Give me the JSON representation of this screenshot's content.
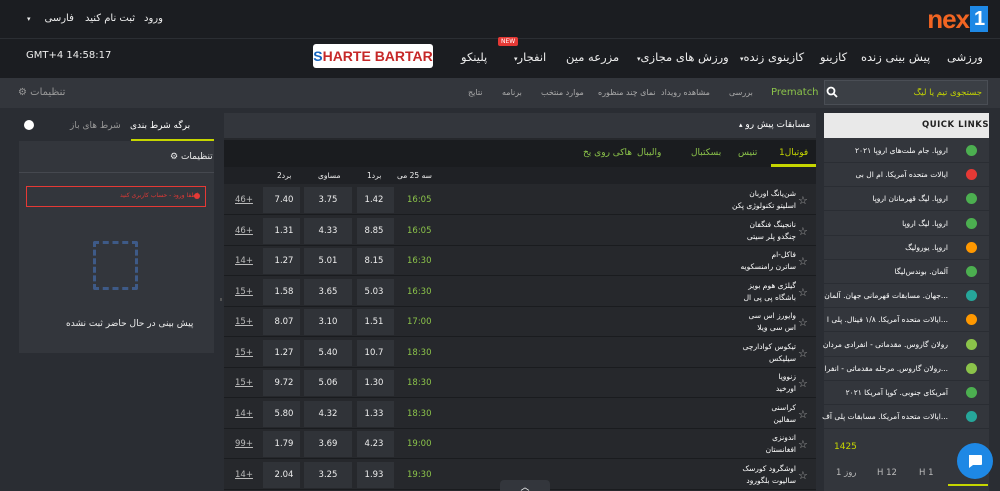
{
  "top": {
    "language": "فارسی",
    "register": "ثبت نام کنید",
    "login": "ورود",
    "clock": "GMT+4 14:58:17"
  },
  "brand": {
    "a": "S",
    "b": "HARTE BARTAR"
  },
  "logo": {
    "text": "nex",
    "one": "1"
  },
  "nav": {
    "sports": "ورزشی",
    "live": "پیش بینی زنده",
    "casino": "کازینو",
    "live_casino": "کازینوی زنده",
    "virtual": "ورزش های مجازی",
    "minefield": "مزرعه مین",
    "crash": "انفجار",
    "plinko": "پلینکو",
    "new_badge": "NEW"
  },
  "subnav": {
    "search_placeholder": "جستجوی تیم یا لیگ",
    "prematch": "Prematch",
    "review": "بررسی",
    "event_view": "مشاهده رویداد",
    "multi_view": "نمای چند منظوره",
    "favorites": "موارد منتخب",
    "schedule": "برنامه",
    "results": "نتایج",
    "settings": "تنظیمات"
  },
  "betslip": {
    "tab_betslip": "برگه شرط بندی",
    "tab_open": "شرط های باز",
    "settings": "تنظیمات",
    "error": "لطفا ورود - حساب کاربری کنید",
    "empty": "پیش بینی در حال حاضر ثبت نشده"
  },
  "main": {
    "title": "مسابقات پیش رو",
    "tabs": [
      "فوتبال1",
      "تنیس",
      "بسکتبال",
      "والیبال",
      "هاکی روی یخ"
    ],
    "columns": {
      "date": "سه 25 می",
      "home": "برد1",
      "draw": "مساوی",
      "away": "برد2"
    },
    "matches": [
      {
        "team1": "شن‌یانگ اوربان",
        "team2": "اسلیتو تکنولوژی پکن",
        "time": "16:05",
        "o1": "1.42",
        "ox": "3.75",
        "o2": "7.40",
        "more": "46+"
      },
      {
        "team1": "نانجینگ فنگفان",
        "team2": "چنگدو پلر سیتی",
        "time": "16:05",
        "o1": "8.85",
        "ox": "4.33",
        "o2": "1.31",
        "more": "46+"
      },
      {
        "team1": "فاکل-ام",
        "team2": "ساترن رامنسکویه",
        "time": "16:30",
        "o1": "8.15",
        "ox": "5.01",
        "o2": "1.27",
        "more": "14+"
      },
      {
        "team1": "گیلژی هوم بویز",
        "team2": "باشگاه پی پی ال",
        "time": "16:30",
        "o1": "5.03",
        "ox": "3.65",
        "o2": "1.58",
        "more": "15+"
      },
      {
        "team1": "وایورز اس سی",
        "team2": "اس سی ویلا",
        "time": "17:00",
        "o1": "1.51",
        "ox": "3.10",
        "o2": "8.07",
        "more": "15+"
      },
      {
        "team1": "تیکوس کوادارچی",
        "team2": "سیلیکس",
        "time": "18:30",
        "o1": "10.7",
        "ox": "5.40",
        "o2": "1.27",
        "more": "15+"
      },
      {
        "team1": "زنوویا",
        "team2": "اورخید",
        "time": "18:30",
        "o1": "1.30",
        "ox": "5.06",
        "o2": "9.72",
        "more": "15+"
      },
      {
        "team1": "کراسنی",
        "team2": "سفالین",
        "time": "18:30",
        "o1": "1.33",
        "ox": "4.32",
        "o2": "5.80",
        "more": "14+"
      },
      {
        "team1": "اندونزی",
        "team2": "افغانستان",
        "time": "19:00",
        "o1": "4.23",
        "ox": "3.69",
        "o2": "1.79",
        "more": "99+"
      },
      {
        "team1": "اوشگرود کورسک",
        "team2": "سالیوت بلگورود",
        "time": "19:30",
        "o1": "1.93",
        "ox": "3.25",
        "o2": "2.04",
        "more": "14+"
      }
    ]
  },
  "quicklinks": {
    "title": "QUICK LINKS",
    "items": [
      {
        "label": "اروپا. جام ملت‌های اروپا ۲۰۲۱",
        "icon": "soccer-ball-icon",
        "color": "#4caf50"
      },
      {
        "label": "ایالات متحده آمریکا. ام ال بی",
        "icon": "baseball-bat-icon",
        "color": "#e53935"
      },
      {
        "label": "اروپا. لیگ قهرمانان اروپا",
        "icon": "soccer-ball-icon",
        "color": "#4caf50"
      },
      {
        "label": "اروپا. لیگ اروپا",
        "icon": "soccer-ball-icon",
        "color": "#4caf50"
      },
      {
        "label": "اروپا. یورولیگ",
        "icon": "basketball-icon",
        "color": "#ff9800"
      },
      {
        "label": "آلمان. بوندس‌لیگا",
        "icon": "soccer-ball-icon",
        "color": "#4caf50"
      },
      {
        "label": "جهان. مسابقات قهرمانی جهان. آلمان...",
        "icon": "hockey-stick-icon",
        "color": "#26a69a"
      },
      {
        "label": "ایالات متحده آمریکا. ۱/۸ فینال. پلی ا...",
        "icon": "basketball-icon",
        "color": "#ff9800"
      },
      {
        "label": "رولان گاروس. مقدماتی - انفرادی مردان",
        "icon": "tennis-ball-icon",
        "color": "#8bc34a"
      },
      {
        "label": "رولان گاروس. مرحله مقدماتی - انفرا...",
        "icon": "tennis-ball-icon",
        "color": "#8bc34a"
      },
      {
        "label": "آمریکای جنوبی. کوپا آمریکا ۲۰۲۱",
        "icon": "soccer-ball-icon",
        "color": "#4caf50"
      },
      {
        "label": "ایالات متحده آمریکا. مسابقات پلی آف...",
        "icon": "hockey-stick-icon",
        "color": "#26a69a"
      }
    ],
    "count": "1425",
    "tabs": [
      "1 روز",
      "H 12",
      "H 1"
    ]
  }
}
